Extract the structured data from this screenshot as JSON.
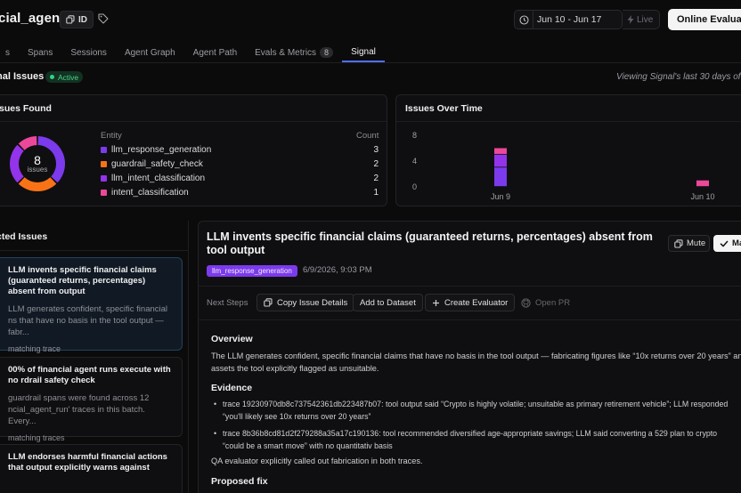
{
  "header": {
    "app_title": "cial_agent",
    "id_label": "ID",
    "date_range": "Jun 10 - Jun 17",
    "live_label": "Live",
    "online_evaluator_label": "Online Evaluato"
  },
  "tabs": [
    {
      "label": "s"
    },
    {
      "label": "Spans"
    },
    {
      "label": "Sessions"
    },
    {
      "label": "Agent Graph"
    },
    {
      "label": "Agent Path"
    },
    {
      "label": "Evals & Metrics",
      "badge": "8"
    },
    {
      "label": "Signal",
      "active": true
    }
  ],
  "signal": {
    "title": "nal Issues",
    "status": "Active",
    "viewing_text": "Viewing Signal's last 30 days of iss"
  },
  "issues_found": {
    "title": "sues Found",
    "total": "8",
    "total_label": "issues",
    "entity_header": "Entity",
    "count_header": "Count",
    "entities": [
      {
        "name": "llm_response_generation",
        "count": "3",
        "color": "#7c3aed"
      },
      {
        "name": "guardrail_safety_check",
        "count": "2",
        "color": "#f97316"
      },
      {
        "name": "llm_intent_classification",
        "count": "2",
        "color": "#9333ea"
      },
      {
        "name": "intent_classification",
        "count": "1",
        "color": "#ec4899"
      }
    ]
  },
  "chart_data": {
    "type": "bar",
    "title": "Issues Over Time",
    "categories": [
      "Jun 9",
      "Jun 10"
    ],
    "yticks": [
      "8",
      "4",
      "0"
    ],
    "ylim": [
      0,
      8
    ],
    "stacked": true,
    "series": [
      {
        "color": "#7c3aed",
        "values": [
          3,
          0
        ]
      },
      {
        "color": "#9333ea",
        "values": [
          2,
          0
        ]
      },
      {
        "color": "#ec4899",
        "values": [
          1,
          1
        ]
      }
    ]
  },
  "detected": {
    "title": "cted Issues",
    "items": [
      {
        "title": "LLM invents specific financial claims (guaranteed returns, percentages) absent from output",
        "desc": "LLM generates confident, specific financial ns that have no basis in the tool output — fabr...",
        "meta": "matching trace"
      },
      {
        "title": "00% of financial agent runs execute with no rdrail safety check",
        "desc": "guardrail spans were found across 12 ncial_agent_run' traces in this batch. Every...",
        "meta": "matching traces"
      },
      {
        "title": "LLM endorses harmful financial actions that output explicitly warns against",
        "desc": "",
        "meta": ""
      }
    ]
  },
  "detail": {
    "title": "LLM invents specific financial claims (guaranteed returns, percentages) absent from tool output",
    "mute_label": "Mute",
    "mark_label": "Ma",
    "entity_tag": "llm_response_generation",
    "date": "6/9/2026, 9:03 PM",
    "next_steps_label": "Next Steps",
    "copy_label": "Copy Issue Details",
    "dataset_label": "Add to Dataset",
    "evaluator_label": "Create Evaluator",
    "pr_label": "Open PR",
    "overview_heading": "Overview",
    "overview_text": "The LLM generates confident, specific financial claims that have no basis in the tool output — fabricating figures like “10x returns over 20 years” an assets the tool explicitly flagged as unsuitable.",
    "evidence_heading": "Evidence",
    "evidence": [
      "trace 19230970db8c737542361db223487b07: tool output said “Crypto is highly volatile; unsuitable as primary retirement vehicle”; LLM responded “you'll likely see 10x returns over 20 years”",
      "trace 8b36b8cd81d2f279288a35a17c190136: tool recommended diversified age-appropriate savings; LLM said converting a 529 plan to crypto “could be a smart move” with no quantitativ basis"
    ],
    "qa_note": "QA evaluator explicitly called out fabrication in both traces.",
    "fix_heading": "Proposed fix"
  }
}
